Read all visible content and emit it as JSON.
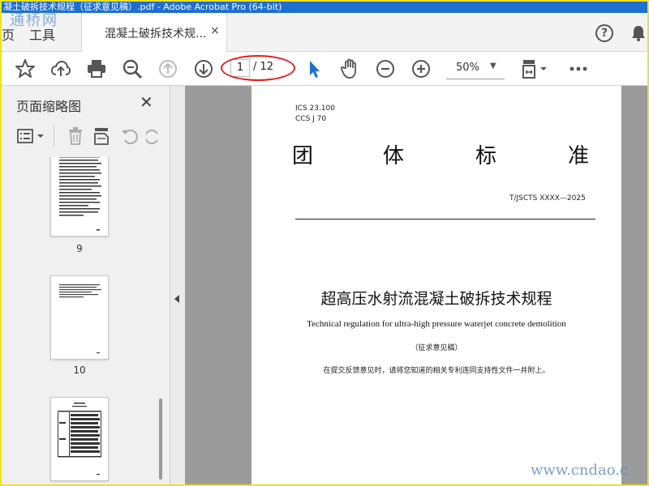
{
  "window": {
    "title": "凝土破拆技术规程（征求意见稿）.pdf - Adobe Acrobat Pro (64-bit)"
  },
  "watermarks": {
    "top": "通桥网",
    "bottom": "www.cndao.c"
  },
  "tabs": {
    "home_label": "页",
    "tools_label": "工具",
    "doc_label": "混凝土破拆技术规...",
    "close_glyph": "×"
  },
  "header": {
    "help_glyph": "?"
  },
  "toolbar": {
    "page_current": "1",
    "page_total": "/ 12",
    "zoom": "50%",
    "zoom_caret": "▼"
  },
  "sidebar": {
    "title": "页面缩略图",
    "close_glyph": "✕",
    "thumbnails": [
      {
        "number": "9"
      },
      {
        "number": "10"
      },
      {
        "number": ""
      }
    ]
  },
  "document": {
    "ics_line": "ICS  23.100",
    "ccs_line": "CCS  J 70",
    "kind_chars": [
      "团",
      "体",
      "标",
      "准"
    ],
    "standard_code": "T/JSCTS XXXX—2025",
    "title_cn": "超高压水射流混凝土破拆技术规程",
    "title_en": "Technical regulation for ultra-high pressure waterjet concrete demolition",
    "draft_label": "（征求意见稿）",
    "note": "在提交反馈意见时，请将您知道的相关专利连同支持性文件一并附上。"
  },
  "colors": {
    "accent": "#1f6fd1",
    "highlight": "#e02020",
    "border": "#f0e21a"
  },
  "icons": [
    "star-icon",
    "cloud-upload-icon",
    "printer-icon",
    "zoom-search-icon",
    "arrow-up-circle-icon",
    "arrow-down-circle-icon",
    "select-arrow-icon",
    "hand-icon",
    "zoom-out-icon",
    "zoom-in-icon",
    "fit-page-icon",
    "more-icon",
    "help-icon",
    "bell-icon",
    "list-view-icon",
    "trash-icon",
    "page-insert-icon",
    "undo-icon",
    "redo-icon"
  ]
}
